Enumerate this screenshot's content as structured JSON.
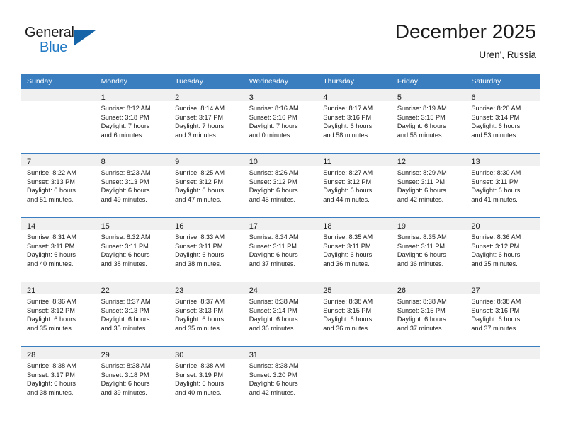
{
  "logo": {
    "word1": "General",
    "word2": "Blue",
    "triangle_color": "#1565a8",
    "blue_color": "#2079c4"
  },
  "header": {
    "month_title": "December 2025",
    "location": "Uren', Russia",
    "header_bg": "#3a7ebf",
    "daynum_bg": "#f0f0f0"
  },
  "weekdays": [
    "Sunday",
    "Monday",
    "Tuesday",
    "Wednesday",
    "Thursday",
    "Friday",
    "Saturday"
  ],
  "weeks": [
    [
      {
        "day": "",
        "sunrise": "",
        "sunset": "",
        "daylight1": "",
        "daylight2": ""
      },
      {
        "day": "1",
        "sunrise": "Sunrise: 8:12 AM",
        "sunset": "Sunset: 3:18 PM",
        "daylight1": "Daylight: 7 hours",
        "daylight2": "and 6 minutes."
      },
      {
        "day": "2",
        "sunrise": "Sunrise: 8:14 AM",
        "sunset": "Sunset: 3:17 PM",
        "daylight1": "Daylight: 7 hours",
        "daylight2": "and 3 minutes."
      },
      {
        "day": "3",
        "sunrise": "Sunrise: 8:16 AM",
        "sunset": "Sunset: 3:16 PM",
        "daylight1": "Daylight: 7 hours",
        "daylight2": "and 0 minutes."
      },
      {
        "day": "4",
        "sunrise": "Sunrise: 8:17 AM",
        "sunset": "Sunset: 3:16 PM",
        "daylight1": "Daylight: 6 hours",
        "daylight2": "and 58 minutes."
      },
      {
        "day": "5",
        "sunrise": "Sunrise: 8:19 AM",
        "sunset": "Sunset: 3:15 PM",
        "daylight1": "Daylight: 6 hours",
        "daylight2": "and 55 minutes."
      },
      {
        "day": "6",
        "sunrise": "Sunrise: 8:20 AM",
        "sunset": "Sunset: 3:14 PM",
        "daylight1": "Daylight: 6 hours",
        "daylight2": "and 53 minutes."
      }
    ],
    [
      {
        "day": "7",
        "sunrise": "Sunrise: 8:22 AM",
        "sunset": "Sunset: 3:13 PM",
        "daylight1": "Daylight: 6 hours",
        "daylight2": "and 51 minutes."
      },
      {
        "day": "8",
        "sunrise": "Sunrise: 8:23 AM",
        "sunset": "Sunset: 3:13 PM",
        "daylight1": "Daylight: 6 hours",
        "daylight2": "and 49 minutes."
      },
      {
        "day": "9",
        "sunrise": "Sunrise: 8:25 AM",
        "sunset": "Sunset: 3:12 PM",
        "daylight1": "Daylight: 6 hours",
        "daylight2": "and 47 minutes."
      },
      {
        "day": "10",
        "sunrise": "Sunrise: 8:26 AM",
        "sunset": "Sunset: 3:12 PM",
        "daylight1": "Daylight: 6 hours",
        "daylight2": "and 45 minutes."
      },
      {
        "day": "11",
        "sunrise": "Sunrise: 8:27 AM",
        "sunset": "Sunset: 3:12 PM",
        "daylight1": "Daylight: 6 hours",
        "daylight2": "and 44 minutes."
      },
      {
        "day": "12",
        "sunrise": "Sunrise: 8:29 AM",
        "sunset": "Sunset: 3:11 PM",
        "daylight1": "Daylight: 6 hours",
        "daylight2": "and 42 minutes."
      },
      {
        "day": "13",
        "sunrise": "Sunrise: 8:30 AM",
        "sunset": "Sunset: 3:11 PM",
        "daylight1": "Daylight: 6 hours",
        "daylight2": "and 41 minutes."
      }
    ],
    [
      {
        "day": "14",
        "sunrise": "Sunrise: 8:31 AM",
        "sunset": "Sunset: 3:11 PM",
        "daylight1": "Daylight: 6 hours",
        "daylight2": "and 40 minutes."
      },
      {
        "day": "15",
        "sunrise": "Sunrise: 8:32 AM",
        "sunset": "Sunset: 3:11 PM",
        "daylight1": "Daylight: 6 hours",
        "daylight2": "and 38 minutes."
      },
      {
        "day": "16",
        "sunrise": "Sunrise: 8:33 AM",
        "sunset": "Sunset: 3:11 PM",
        "daylight1": "Daylight: 6 hours",
        "daylight2": "and 38 minutes."
      },
      {
        "day": "17",
        "sunrise": "Sunrise: 8:34 AM",
        "sunset": "Sunset: 3:11 PM",
        "daylight1": "Daylight: 6 hours",
        "daylight2": "and 37 minutes."
      },
      {
        "day": "18",
        "sunrise": "Sunrise: 8:35 AM",
        "sunset": "Sunset: 3:11 PM",
        "daylight1": "Daylight: 6 hours",
        "daylight2": "and 36 minutes."
      },
      {
        "day": "19",
        "sunrise": "Sunrise: 8:35 AM",
        "sunset": "Sunset: 3:11 PM",
        "daylight1": "Daylight: 6 hours",
        "daylight2": "and 36 minutes."
      },
      {
        "day": "20",
        "sunrise": "Sunrise: 8:36 AM",
        "sunset": "Sunset: 3:12 PM",
        "daylight1": "Daylight: 6 hours",
        "daylight2": "and 35 minutes."
      }
    ],
    [
      {
        "day": "21",
        "sunrise": "Sunrise: 8:36 AM",
        "sunset": "Sunset: 3:12 PM",
        "daylight1": "Daylight: 6 hours",
        "daylight2": "and 35 minutes."
      },
      {
        "day": "22",
        "sunrise": "Sunrise: 8:37 AM",
        "sunset": "Sunset: 3:13 PM",
        "daylight1": "Daylight: 6 hours",
        "daylight2": "and 35 minutes."
      },
      {
        "day": "23",
        "sunrise": "Sunrise: 8:37 AM",
        "sunset": "Sunset: 3:13 PM",
        "daylight1": "Daylight: 6 hours",
        "daylight2": "and 35 minutes."
      },
      {
        "day": "24",
        "sunrise": "Sunrise: 8:38 AM",
        "sunset": "Sunset: 3:14 PM",
        "daylight1": "Daylight: 6 hours",
        "daylight2": "and 36 minutes."
      },
      {
        "day": "25",
        "sunrise": "Sunrise: 8:38 AM",
        "sunset": "Sunset: 3:15 PM",
        "daylight1": "Daylight: 6 hours",
        "daylight2": "and 36 minutes."
      },
      {
        "day": "26",
        "sunrise": "Sunrise: 8:38 AM",
        "sunset": "Sunset: 3:15 PM",
        "daylight1": "Daylight: 6 hours",
        "daylight2": "and 37 minutes."
      },
      {
        "day": "27",
        "sunrise": "Sunrise: 8:38 AM",
        "sunset": "Sunset: 3:16 PM",
        "daylight1": "Daylight: 6 hours",
        "daylight2": "and 37 minutes."
      }
    ],
    [
      {
        "day": "28",
        "sunrise": "Sunrise: 8:38 AM",
        "sunset": "Sunset: 3:17 PM",
        "daylight1": "Daylight: 6 hours",
        "daylight2": "and 38 minutes."
      },
      {
        "day": "29",
        "sunrise": "Sunrise: 8:38 AM",
        "sunset": "Sunset: 3:18 PM",
        "daylight1": "Daylight: 6 hours",
        "daylight2": "and 39 minutes."
      },
      {
        "day": "30",
        "sunrise": "Sunrise: 8:38 AM",
        "sunset": "Sunset: 3:19 PM",
        "daylight1": "Daylight: 6 hours",
        "daylight2": "and 40 minutes."
      },
      {
        "day": "31",
        "sunrise": "Sunrise: 8:38 AM",
        "sunset": "Sunset: 3:20 PM",
        "daylight1": "Daylight: 6 hours",
        "daylight2": "and 42 minutes."
      },
      {
        "day": "",
        "sunrise": "",
        "sunset": "",
        "daylight1": "",
        "daylight2": ""
      },
      {
        "day": "",
        "sunrise": "",
        "sunset": "",
        "daylight1": "",
        "daylight2": ""
      },
      {
        "day": "",
        "sunrise": "",
        "sunset": "",
        "daylight1": "",
        "daylight2": ""
      }
    ]
  ]
}
